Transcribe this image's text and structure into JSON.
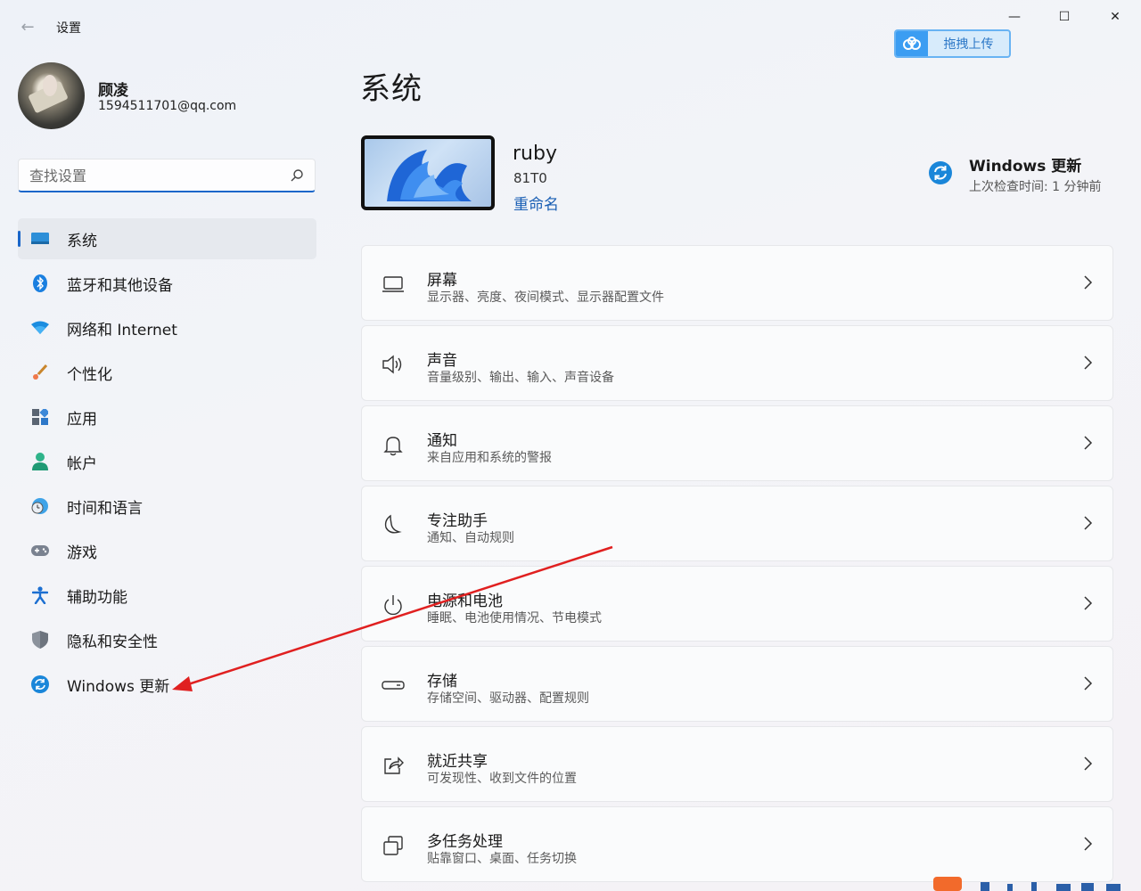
{
  "window": {
    "title": "设置",
    "back_glyph": "←",
    "minimize_glyph": "—",
    "maximize_glyph": "☐",
    "close_glyph": "✕"
  },
  "upload_badge": {
    "label": "拖拽上传"
  },
  "profile": {
    "name": "顾凌",
    "email": "1594511701@qq.com"
  },
  "search": {
    "placeholder": "查找设置"
  },
  "sidebar": {
    "items": [
      {
        "label": "系统",
        "icon": "display-icon",
        "active": true
      },
      {
        "label": "蓝牙和其他设备",
        "icon": "bluetooth-icon"
      },
      {
        "label": "网络和 Internet",
        "icon": "wifi-icon"
      },
      {
        "label": "个性化",
        "icon": "brush-icon"
      },
      {
        "label": "应用",
        "icon": "apps-icon"
      },
      {
        "label": "帐户",
        "icon": "account-icon"
      },
      {
        "label": "时间和语言",
        "icon": "globe-clock-icon"
      },
      {
        "label": "游戏",
        "icon": "gamepad-icon"
      },
      {
        "label": "辅助功能",
        "icon": "accessibility-icon"
      },
      {
        "label": "隐私和安全性",
        "icon": "shield-icon"
      },
      {
        "label": "Windows 更新",
        "icon": "update-icon"
      }
    ]
  },
  "main": {
    "title": "系统",
    "device": {
      "name": "ruby",
      "model": "81T0",
      "rename": "重命名"
    },
    "windows_update": {
      "title": "Windows 更新",
      "subtitle": "上次检查时间: 1 分钟前"
    },
    "cards": [
      {
        "title": "屏幕",
        "subtitle": "显示器、亮度、夜间模式、显示器配置文件",
        "icon": "monitor-icon"
      },
      {
        "title": "声音",
        "subtitle": "音量级别、输出、输入、声音设备",
        "icon": "speaker-icon"
      },
      {
        "title": "通知",
        "subtitle": "来自应用和系统的警报",
        "icon": "bell-icon"
      },
      {
        "title": "专注助手",
        "subtitle": "通知、自动规则",
        "icon": "moon-icon"
      },
      {
        "title": "电源和电池",
        "subtitle": "睡眠、电池使用情况、节电模式",
        "icon": "power-icon"
      },
      {
        "title": "存储",
        "subtitle": "存储空间、驱动器、配置规则",
        "icon": "storage-icon"
      },
      {
        "title": "就近共享",
        "subtitle": "可发现性、收到文件的位置",
        "icon": "share-icon"
      },
      {
        "title": "多任务处理",
        "subtitle": "贴靠窗口、桌面、任务切换",
        "icon": "multitask-icon"
      }
    ]
  },
  "colors": {
    "accent": "#1a66c9",
    "annotation_arrow": "#e02020"
  }
}
